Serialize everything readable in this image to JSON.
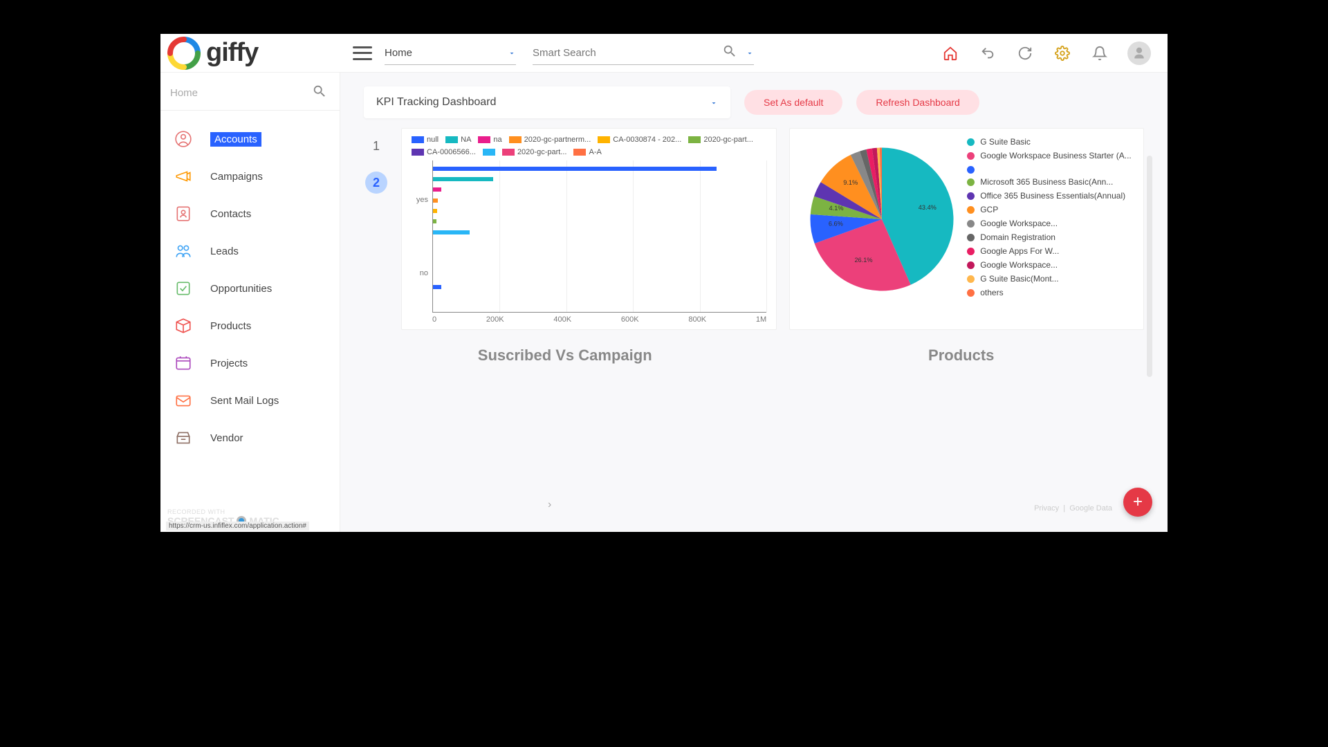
{
  "brand": {
    "name": "giffy"
  },
  "topnav": {
    "selector_label": "Home",
    "search_placeholder": "Smart Search"
  },
  "sidebar": {
    "search_placeholder": "Home",
    "items": [
      {
        "label": "Accounts",
        "icon": "user-circle",
        "active": true
      },
      {
        "label": "Campaigns",
        "icon": "campaign"
      },
      {
        "label": "Contacts",
        "icon": "contact"
      },
      {
        "label": "Leads",
        "icon": "leads"
      },
      {
        "label": "Opportunities",
        "icon": "opportunity"
      },
      {
        "label": "Products",
        "icon": "product"
      },
      {
        "label": "Projects",
        "icon": "project"
      },
      {
        "label": "Sent Mail Logs",
        "icon": "mail"
      },
      {
        "label": "Vendor",
        "icon": "vendor"
      }
    ]
  },
  "dashboard_selector": "KPI Tracking Dashboard",
  "buttons": {
    "set_default": "Set As default",
    "refresh": "Refresh Dashboard"
  },
  "steps": [
    "1",
    "2"
  ],
  "section_titles": {
    "left": "Suscribed Vs Campaign",
    "right": "Products"
  },
  "footer": {
    "privacy": "Privacy",
    "google": "Google Data"
  },
  "watermark": {
    "line1": "RECORDED WITH",
    "line2": "SCREENCAST",
    "line2b": "MATIC"
  },
  "status_url": "https://crm-us.infiflex.com/application.action#",
  "chart_data": [
    {
      "type": "bar",
      "orientation": "horizontal",
      "xlabel": "",
      "ylabel": "",
      "x_ticks": [
        "0",
        "200K",
        "400K",
        "600K",
        "800K",
        "1M"
      ],
      "y_categories": [
        "yes",
        "no"
      ],
      "xlim": [
        0,
        1000000
      ],
      "legend": [
        {
          "name": "null",
          "color": "#2962ff"
        },
        {
          "name": "NA",
          "color": "#16b9c1"
        },
        {
          "name": "na",
          "color": "#e91e8c"
        },
        {
          "name": "2020-gc-partnerm...",
          "color": "#ff8f1f"
        },
        {
          "name": "CA-0030874 - 202...",
          "color": "#ffb300"
        },
        {
          "name": "2020-gc-part...",
          "color": "#7cb342"
        },
        {
          "name": "CA-0006566...",
          "color": "#5e35b1"
        },
        {
          "name": "",
          "color": "#29b6f6"
        },
        {
          "name": "2020-gc-part...",
          "color": "#ec407a"
        },
        {
          "name": "A-A",
          "color": "#ff7043"
        }
      ],
      "bars": [
        {
          "group": "yes",
          "series": "null",
          "value": 850000,
          "color": "#2962ff"
        },
        {
          "group": "yes",
          "series": "NA",
          "value": 180000,
          "color": "#16b9c1"
        },
        {
          "group": "yes",
          "series": "na",
          "value": 25000,
          "color": "#e91e8c"
        },
        {
          "group": "yes",
          "series": "2020-gc-partnerm...",
          "value": 15000,
          "color": "#ff8f1f"
        },
        {
          "group": "yes",
          "series": "CA-0030874",
          "value": 12000,
          "color": "#ffb300"
        },
        {
          "group": "yes",
          "series": "2020-gc-part...",
          "value": 10000,
          "color": "#7cb342"
        },
        {
          "group": "yes",
          "series": "blank",
          "value": 110000,
          "color": "#29b6f6"
        },
        {
          "group": "no",
          "series": "null",
          "value": 25000,
          "color": "#2962ff"
        }
      ]
    },
    {
      "type": "pie",
      "title": "",
      "slices": [
        {
          "name": "G Suite Basic",
          "value": 43.4,
          "color": "#16b9c1",
          "label": "43.4%"
        },
        {
          "name": "Google Workspace Business Starter (A...",
          "value": 26.1,
          "color": "#ec407a",
          "label": "26.1%"
        },
        {
          "name": "",
          "value": 6.6,
          "color": "#2962ff",
          "label": "6.6%"
        },
        {
          "name": "Microsoft 365 Business Basic(Ann...",
          "value": 4.1,
          "color": "#7cb342",
          "label": "4.1%"
        },
        {
          "name": "Office 365 Business Essentials(Annual)",
          "value": 3.5,
          "color": "#5e35b1"
        },
        {
          "name": "GCP",
          "value": 9.1,
          "color": "#ff8f1f",
          "label": "9.1%"
        },
        {
          "name": "Google Workspace...",
          "value": 2.2,
          "color": "#888"
        },
        {
          "name": "Domain Registration",
          "value": 1.5,
          "color": "#666"
        },
        {
          "name": "Google Apps For W...",
          "value": 1.3,
          "color": "#e91e63"
        },
        {
          "name": "Google Workspace...",
          "value": 1.1,
          "color": "#c2185b"
        },
        {
          "name": "G Suite Basic(Mont...",
          "value": 0.6,
          "color": "#ffb74d"
        },
        {
          "name": "others",
          "value": 0.5,
          "color": "#ff7043"
        }
      ]
    }
  ]
}
